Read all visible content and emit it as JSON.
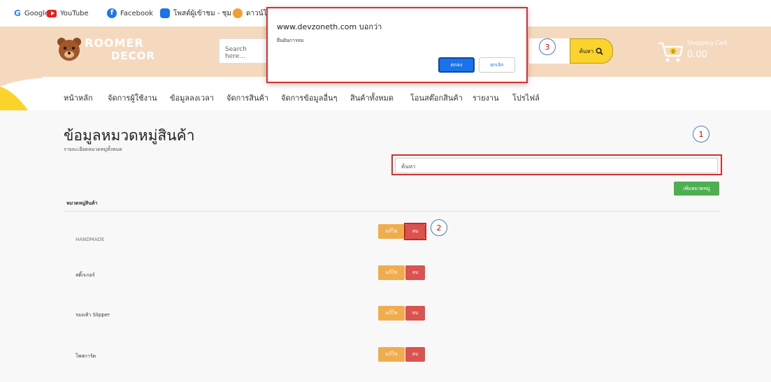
{
  "bookmarks": [
    {
      "label": "Google",
      "icon": "google-icon",
      "color": "#4285f4"
    },
    {
      "label": "YouTube",
      "icon": "youtube-icon",
      "color": "#e62117"
    },
    {
      "label": "Facebook",
      "icon": "facebook-icon",
      "color": "#1877f2"
    },
    {
      "label": "โพสต์ผู้เข้าชม - ชุม",
      "icon": "chat-icon",
      "color": "#1a73e8"
    },
    {
      "label": "ดาวน์โ",
      "icon": "download-icon",
      "color": "#f0a030"
    }
  ],
  "header": {
    "logo_line1": "ROOMER",
    "logo_line2": "DECOR",
    "search_placeholder": "Search here...",
    "search_button": "ค้นหา",
    "cart_label": "Shopping Cart",
    "cart_count": "0",
    "cart_total": "0.00",
    "bg_color": "#f5d9bf"
  },
  "nav": {
    "items": [
      "หน้าหลัก",
      "จัดการผู้ใช้งาน",
      "ข้อมูลลงเวลา",
      "จัดการสินค้า",
      "จัดการข้อมูลอื่นๆ",
      "สินค้าทั้งหมด",
      "โอนสต๊อกสินค้า",
      "รายงาน",
      "โปรไฟล์"
    ]
  },
  "page": {
    "title": "ข้อมูลหมวดหมู่สินค้า",
    "subtitle": "รายละเอียดหมวดหมู่ทั้งหมด",
    "filter_placeholder": "ค้นหา",
    "add_button": "เพิ่มหมวดหมู่",
    "column_header": "หมวดหมู่สินค้า",
    "edit_label": "แก้ไข",
    "delete_label": "ลบ",
    "rows": [
      {
        "name": "HANDMADE"
      },
      {
        "name": "สติ๊กเกอร์"
      },
      {
        "name": "รองเท้า Slipper"
      },
      {
        "name": "โพสการ์ด"
      }
    ]
  },
  "dialog": {
    "site": "www.devzoneth.com บอกว่า",
    "message": "ยืนยันการลบ",
    "ok_label": "ตกลง",
    "cancel_label": "ยกเลิก"
  },
  "annotations": [
    "1",
    "2",
    "3"
  ]
}
